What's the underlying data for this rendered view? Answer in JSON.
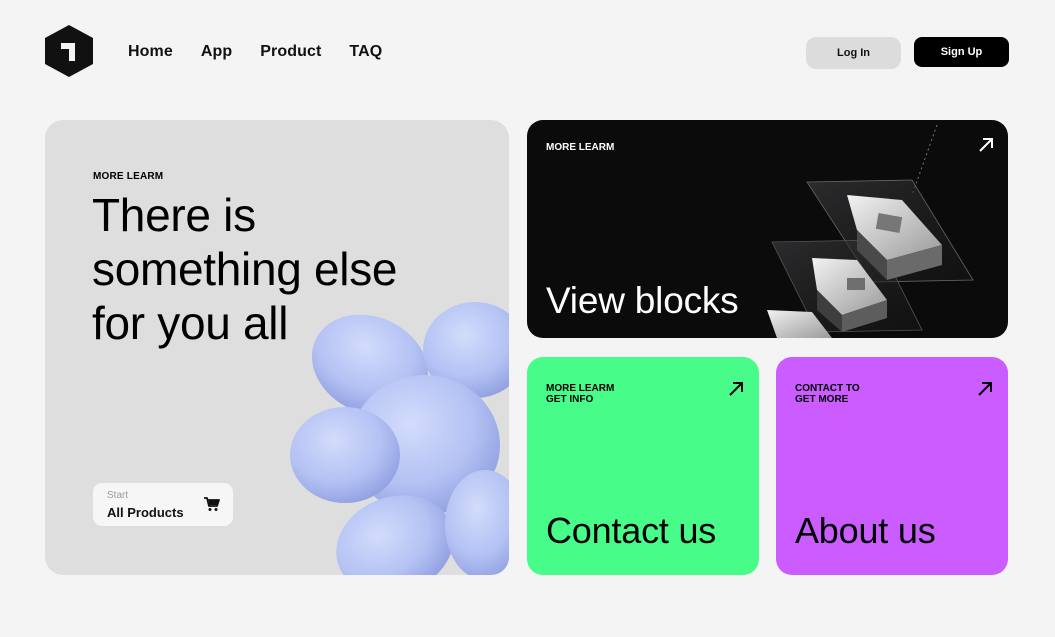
{
  "nav": {
    "items": [
      {
        "label": "Home"
      },
      {
        "label": "App"
      },
      {
        "label": "Product"
      },
      {
        "label": "TAQ"
      }
    ]
  },
  "auth": {
    "login_label": "Log In",
    "signup_label": "Sign Up"
  },
  "hero": {
    "eyebrow": "MORE LEARM",
    "headline": "There is something else for you all",
    "start": {
      "small_label": "Start",
      "label": "All Products",
      "icon": "cart-icon"
    }
  },
  "blocks_card": {
    "eyebrow": "MORE LEARM",
    "title": "View blocks",
    "icon": "arrow-up-right-icon"
  },
  "contact_card": {
    "eyebrow_line1": "MORE LEARM",
    "eyebrow_line2": "GET INFO",
    "title": "Contact us",
    "icon": "arrow-up-right-icon"
  },
  "about_card": {
    "eyebrow_line1": "CONTACT TO",
    "eyebrow_line2": "GET MORE",
    "title": "About us",
    "icon": "arrow-up-right-icon"
  },
  "colors": {
    "background": "#f4f4f4",
    "hero_card": "#dedede",
    "blocks_card": "#0b0b0c",
    "contact_card": "#47fc88",
    "about_card": "#cb5cff",
    "signup_button": "#000000",
    "login_button": "#dcdcdc",
    "shape_accent": "#b4c2f4"
  }
}
